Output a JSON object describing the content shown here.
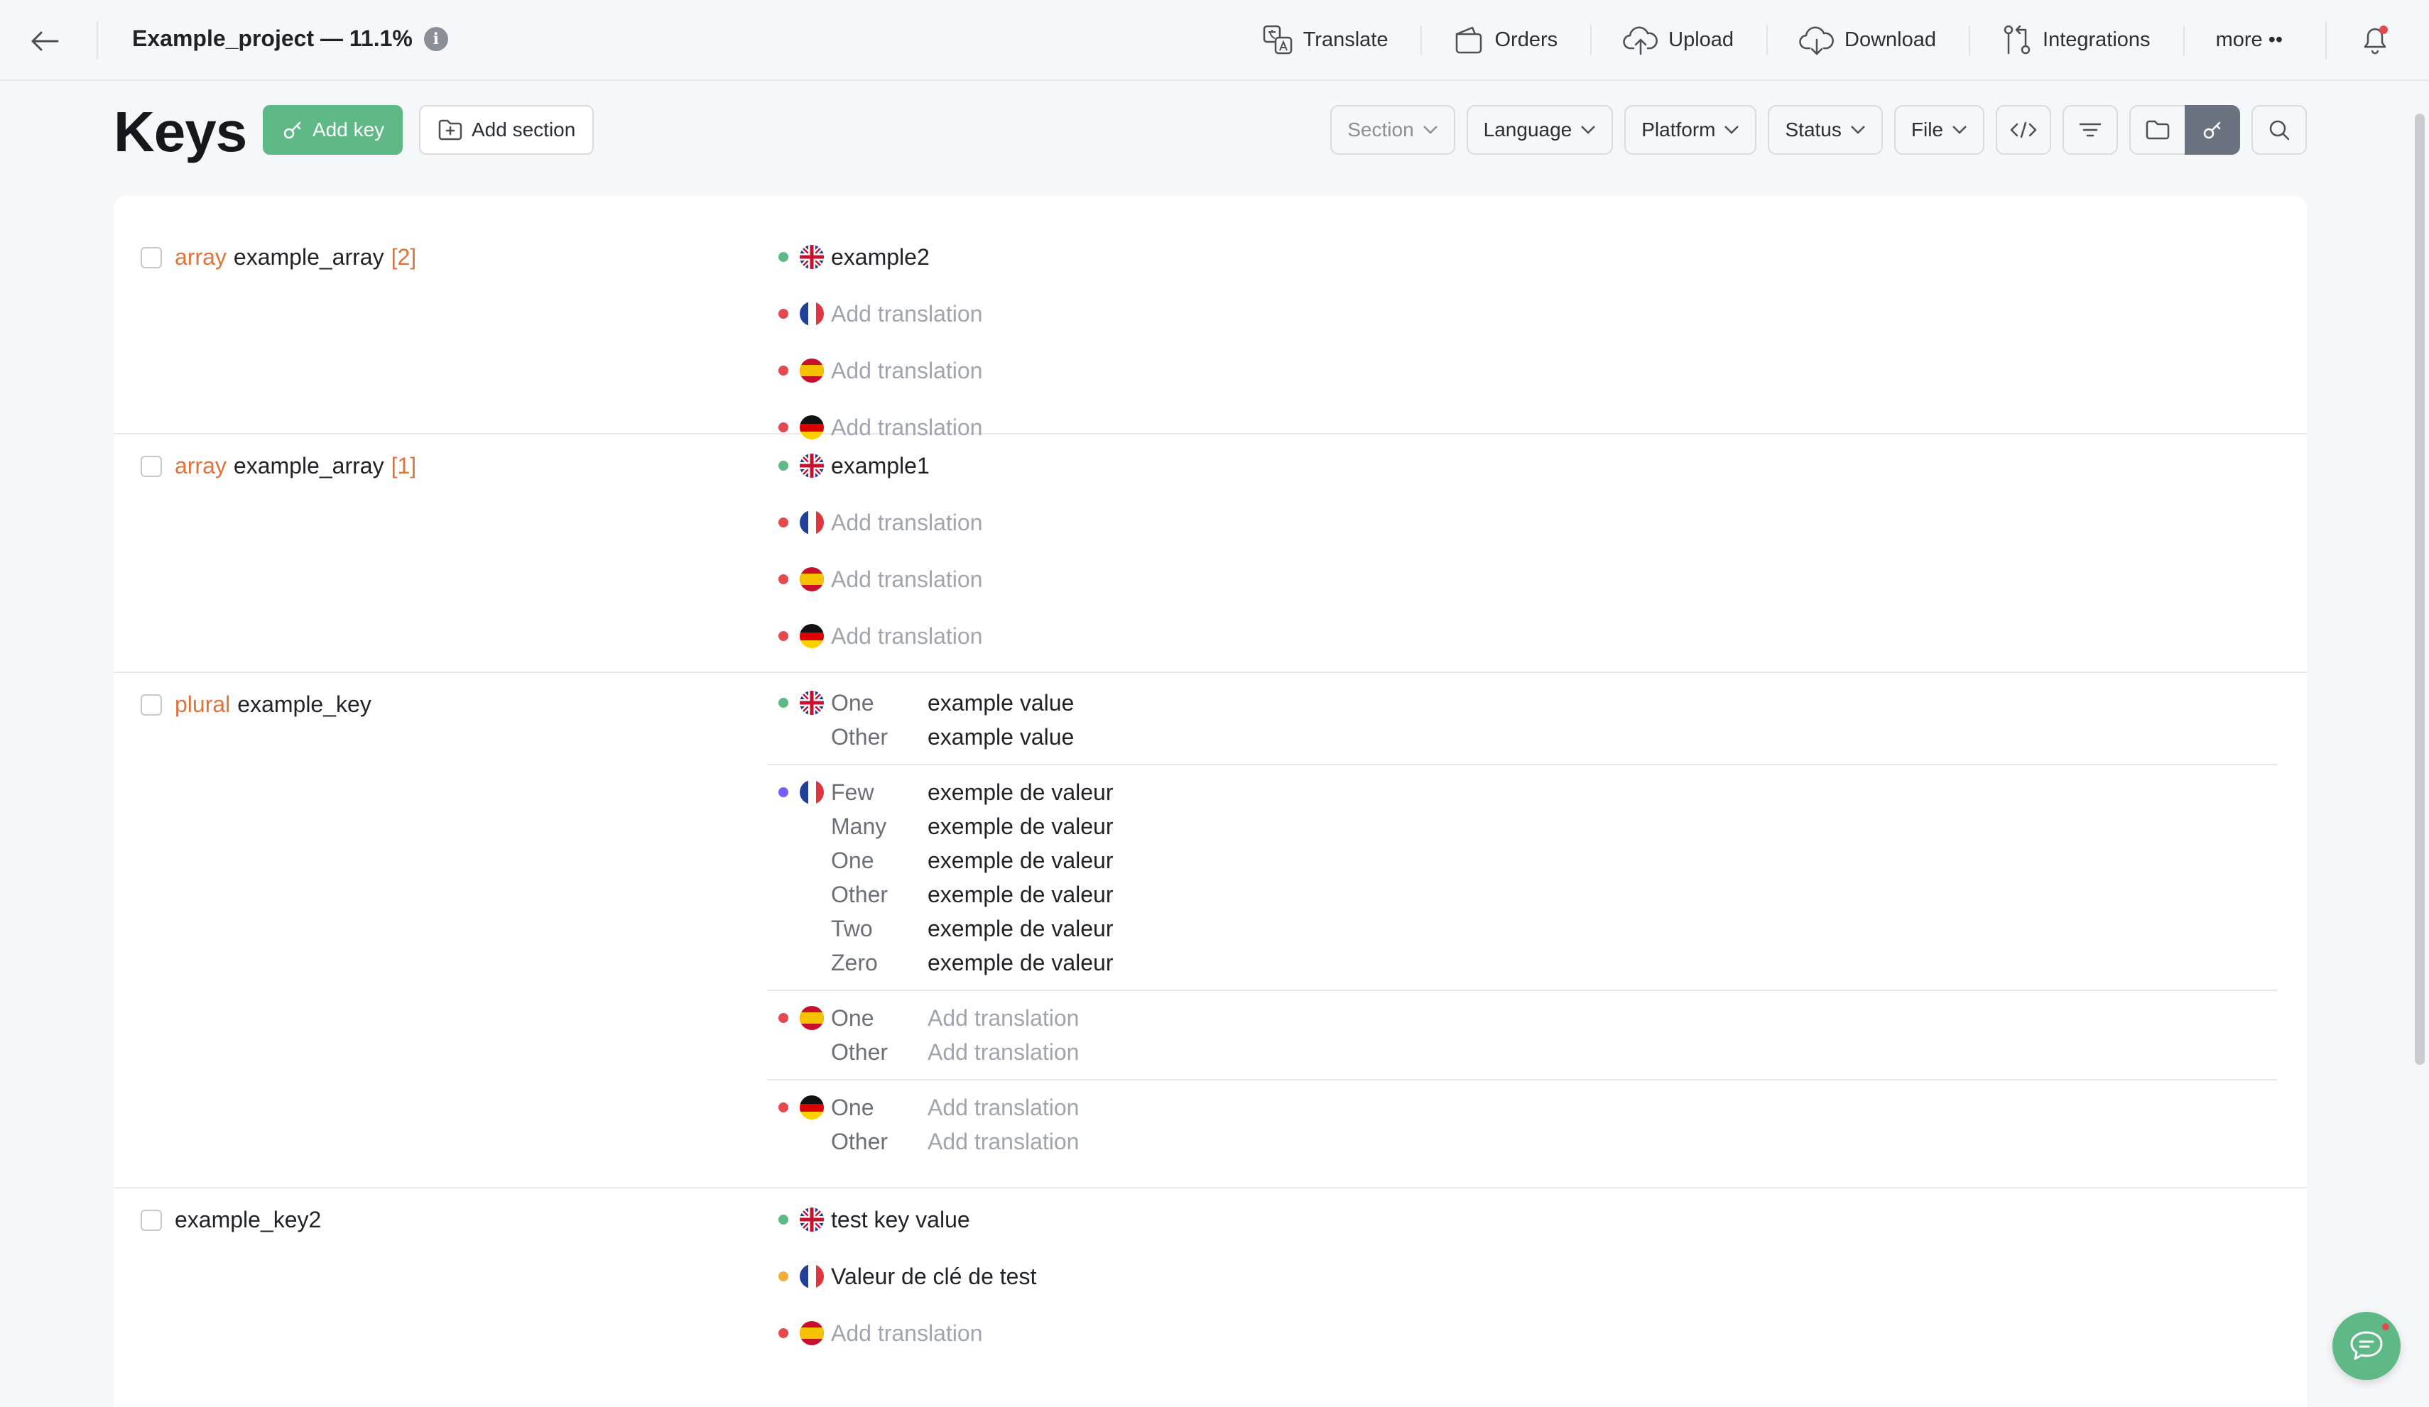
{
  "header": {
    "project_title": "Example_project — 11.1%",
    "nav": [
      {
        "label": "Translate",
        "icon": "translate-icon"
      },
      {
        "label": "Orders",
        "icon": "wallet-icon"
      },
      {
        "label": "Upload",
        "icon": "upload-cloud-icon"
      },
      {
        "label": "Download",
        "icon": "download-cloud-icon"
      },
      {
        "label": "Integrations",
        "icon": "integrations-icon"
      },
      {
        "label": "more ••",
        "icon": ""
      }
    ]
  },
  "toolbar": {
    "title": "Keys",
    "add_key": "Add key",
    "add_section": "Add section",
    "filters": [
      "Section",
      "Language",
      "Platform",
      "Status",
      "File"
    ]
  },
  "colors": {
    "accent": "#5fb987",
    "status_done": "#5fb987",
    "status_missing": "#e5484d",
    "status_review": "#7c5cff",
    "status_partial": "#f0ad3a",
    "key_kind": "#e0733c"
  },
  "keys": [
    {
      "kind": "array",
      "name": "example_array",
      "index": "[2]",
      "translations": [
        {
          "lang": "en",
          "status": "done",
          "value": "example2"
        },
        {
          "lang": "fr",
          "status": "missing",
          "value": "Add translation"
        },
        {
          "lang": "es",
          "status": "missing",
          "value": "Add translation"
        },
        {
          "lang": "de",
          "status": "missing",
          "value": "Add translation"
        }
      ]
    },
    {
      "kind": "array",
      "name": "example_array",
      "index": "[1]",
      "translations": [
        {
          "lang": "en",
          "status": "done",
          "value": "example1"
        },
        {
          "lang": "fr",
          "status": "missing",
          "value": "Add translation"
        },
        {
          "lang": "es",
          "status": "missing",
          "value": "Add translation"
        },
        {
          "lang": "de",
          "status": "missing",
          "value": "Add translation"
        }
      ]
    },
    {
      "kind": "plural",
      "name": "example_key",
      "plurals": [
        {
          "lang": "en",
          "status": "done",
          "forms": [
            [
              "One",
              "example value"
            ],
            [
              "Other",
              "example value"
            ]
          ]
        },
        {
          "lang": "fr",
          "status": "review",
          "forms": [
            [
              "Few",
              "exemple de valeur"
            ],
            [
              "Many",
              "exemple de valeur"
            ],
            [
              "One",
              "exemple de valeur"
            ],
            [
              "Other",
              "exemple de valeur"
            ],
            [
              "Two",
              "exemple de valeur"
            ],
            [
              "Zero",
              "exemple de valeur"
            ]
          ]
        },
        {
          "lang": "es",
          "status": "missing",
          "forms": [
            [
              "One",
              "Add translation"
            ],
            [
              "Other",
              "Add translation"
            ]
          ]
        },
        {
          "lang": "de",
          "status": "missing",
          "forms": [
            [
              "One",
              "Add translation"
            ],
            [
              "Other",
              "Add translation"
            ]
          ]
        }
      ]
    },
    {
      "kind": "",
      "name": "example_key2",
      "translations": [
        {
          "lang": "en",
          "status": "done",
          "value": "test key value"
        },
        {
          "lang": "fr",
          "status": "partial",
          "value": "Valeur de clé de test"
        },
        {
          "lang": "es",
          "status": "missing",
          "value": "Add translation"
        }
      ]
    }
  ]
}
